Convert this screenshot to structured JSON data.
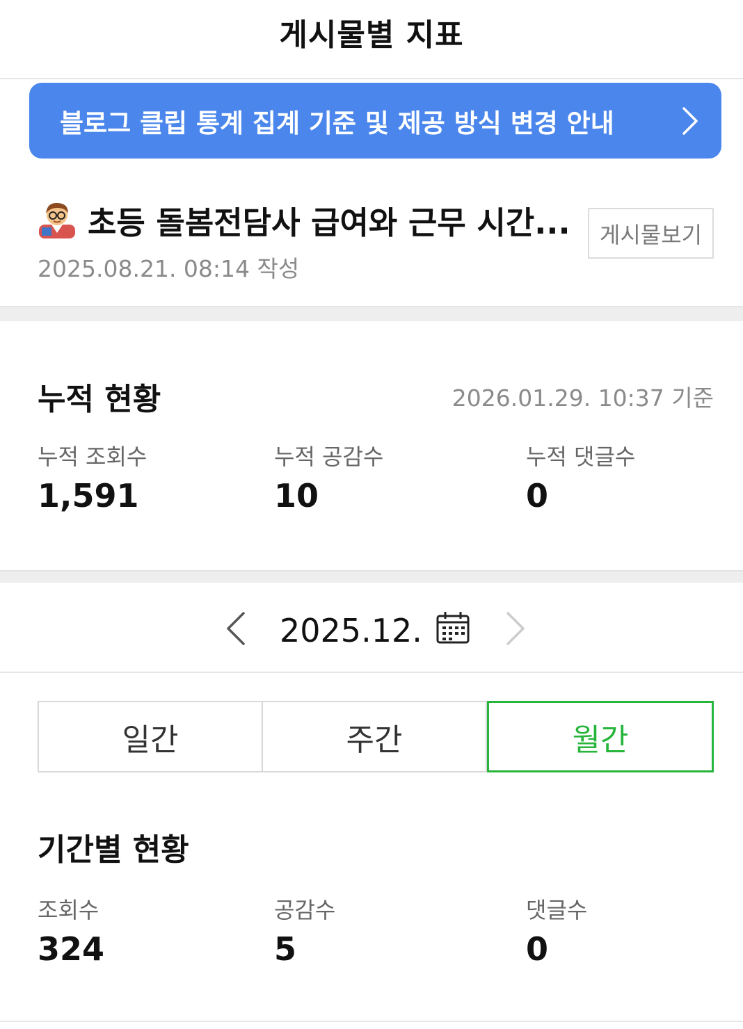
{
  "header": {
    "title": "게시물별 지표"
  },
  "notice": {
    "text": "블로그 클립 통계 집계 기준 및 제공 방식 변경 안내",
    "icon": "chevron-right-icon",
    "color": "#4a86ec"
  },
  "post": {
    "emoji_icon": "teacher-emoji-icon",
    "title": "초등 돌봄전담사 급여와 근무 시간...",
    "date": "2025.08.21. 08:14 작성",
    "view_button": "게시물보기"
  },
  "cumulative": {
    "title": "누적 현황",
    "as_of": "2026.01.29. 10:37 기준",
    "stats": [
      {
        "label": "누적 조회수",
        "value": "1,591"
      },
      {
        "label": "누적 공감수",
        "value": "10"
      },
      {
        "label": "누적 댓글수",
        "value": "0"
      }
    ]
  },
  "month_nav": {
    "label": "2025.12.",
    "prev_icon": "chevron-left-icon",
    "next_icon": "chevron-right-icon",
    "calendar_icon": "calendar-icon"
  },
  "tabs": [
    {
      "label": "일간",
      "active": false
    },
    {
      "label": "주간",
      "active": false
    },
    {
      "label": "월간",
      "active": true
    }
  ],
  "accent_color": "#27b53b",
  "period": {
    "title": "기간별 현황",
    "stats": [
      {
        "label": "조회수",
        "value": "324"
      },
      {
        "label": "공감수",
        "value": "5"
      },
      {
        "label": "댓글수",
        "value": "0"
      }
    ]
  }
}
